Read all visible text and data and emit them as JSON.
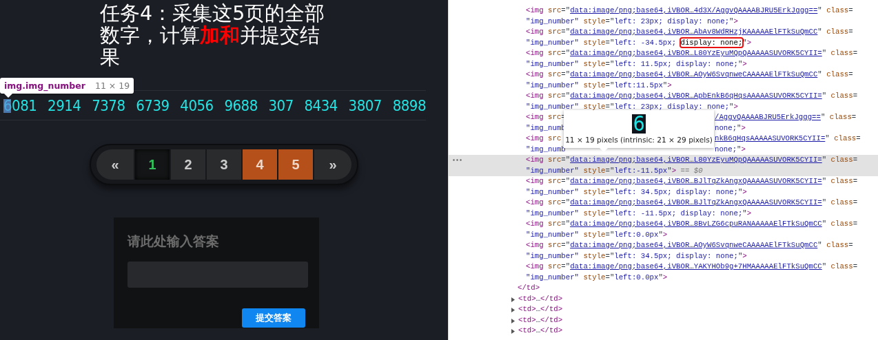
{
  "task_page": {
    "title": "任务4：采集这5页的全部数字，计算**加和**并提交结果",
    "inspect_tooltip": {
      "selector": "img.img_number",
      "size": "11 × 19"
    },
    "numbers": [
      "6081",
      "2914",
      "7378",
      "6739",
      "4056",
      "9688",
      "307",
      "8434",
      "3807",
      "8898"
    ],
    "pages": [
      {
        "label": "«",
        "kind": "arrow",
        "selected": false,
        "visited": false
      },
      {
        "label": "1",
        "kind": "page",
        "selected": true,
        "visited": false
      },
      {
        "label": "2",
        "kind": "page",
        "selected": false,
        "visited": false
      },
      {
        "label": "3",
        "kind": "page",
        "selected": false,
        "visited": false
      },
      {
        "label": "4",
        "kind": "page",
        "selected": false,
        "visited": true
      },
      {
        "label": "5",
        "kind": "page",
        "selected": false,
        "visited": true
      },
      {
        "label": "»",
        "kind": "arrow",
        "selected": false,
        "visited": false
      }
    ],
    "answer_card": {
      "title": "请此处输入答案",
      "submit_button": "提交答案"
    }
  },
  "devtools": {
    "image_tooltip": {
      "preview": "6",
      "caption": "11 × 19 pixels (intrinsic: 21 × 29 pixels)"
    },
    "dom_tree": [
      {
        "kind": "element",
        "expanded": true,
        "children": [
          {
            "kind": "img",
            "selected": false,
            "lines": [
              [
                [
                  {
                    "kind": "tag",
                    "text": "<img "
                  },
                  {
                    "kind": "attr",
                    "text": "src"
                  },
                  {
                    "kind": "eq",
                    "text": "=\""
                  },
                  {
                    "kind": "link",
                    "text": "data:image/png;base64,iVBOR…4d3X/AggvQAAAABJRU5ErkJggg=="
                  },
                  {
                    "kind": "eq",
                    "text": "\" "
                  },
                  {
                    "kind": "attr",
                    "text": "class"
                  },
                  {
                    "kind": "eq",
                    "text": "="
                  }
                ]
              ],
              [
                [
                  {
                    "kind": "val",
                    "text": "\"img_number\" "
                  },
                  {
                    "kind": "attr",
                    "text": "style"
                  },
                  {
                    "kind": "eq",
                    "text": "=\""
                  },
                  {
                    "kind": "val",
                    "text": "left: 23px; display: none;"
                  },
                  {
                    "kind": "eq",
                    "text": "\""
                  },
                  {
                    "kind": "tag",
                    "text": ">"
                  }
                ]
              ]
            ]
          },
          {
            "kind": "img",
            "selected": false,
            "lines": [
              [
                [
                  {
                    "kind": "tag",
                    "text": "<img "
                  },
                  {
                    "kind": "attr",
                    "text": "src"
                  },
                  {
                    "kind": "eq",
                    "text": "=\""
                  },
                  {
                    "kind": "link",
                    "text": "data:image/png;base64,iVBOR…AbAv8WdRHzjKAAAAAElFTkSuQmCC"
                  },
                  {
                    "kind": "eq",
                    "text": "\" "
                  },
                  {
                    "kind": "attr",
                    "text": "class"
                  },
                  {
                    "kind": "eq",
                    "text": "="
                  }
                ]
              ],
              [
                [
                  {
                    "kind": "val",
                    "text": "\"img_number\" "
                  },
                  {
                    "kind": "attr",
                    "text": "style"
                  },
                  {
                    "kind": "eq",
                    "text": "=\""
                  },
                  {
                    "kind": "val",
                    "text": "left: -34.5px; "
                  },
                  {
                    "kind": "boxed",
                    "text": "display: none;"
                  },
                  {
                    "kind": "eq",
                    "text": "\""
                  },
                  {
                    "kind": "tag",
                    "text": ">"
                  }
                ]
              ]
            ]
          },
          {
            "kind": "img",
            "selected": false,
            "lines": [
              [
                [
                  {
                    "kind": "tag",
                    "text": "<img "
                  },
                  {
                    "kind": "attr",
                    "text": "src"
                  },
                  {
                    "kind": "eq",
                    "text": "=\""
                  },
                  {
                    "kind": "link",
                    "text": "data:image/png;base64,iVBOR…L80YzEyuMQpQAAAAASUVORK5CYII="
                  },
                  {
                    "kind": "eq",
                    "text": "\" "
                  },
                  {
                    "kind": "attr",
                    "text": "class"
                  },
                  {
                    "kind": "eq",
                    "text": "="
                  }
                ]
              ],
              [
                [
                  {
                    "kind": "val",
                    "text": "\"img_number\" "
                  },
                  {
                    "kind": "attr",
                    "text": "style"
                  },
                  {
                    "kind": "eq",
                    "text": "=\""
                  },
                  {
                    "kind": "val",
                    "text": "left: 11.5px; display: none;"
                  },
                  {
                    "kind": "eq",
                    "text": "\""
                  },
                  {
                    "kind": "tag",
                    "text": ">"
                  }
                ]
              ]
            ]
          },
          {
            "kind": "img",
            "selected": false,
            "lines": [
              [
                [
                  {
                    "kind": "tag",
                    "text": "<img "
                  },
                  {
                    "kind": "attr",
                    "text": "src"
                  },
                  {
                    "kind": "eq",
                    "text": "=\""
                  },
                  {
                    "kind": "link",
                    "text": "data:image/png;base64,iVBOR…AOyW6SvqnweCAAAAAElFTkSuQmCC"
                  },
                  {
                    "kind": "eq",
                    "text": "\" "
                  },
                  {
                    "kind": "attr",
                    "text": "class"
                  },
                  {
                    "kind": "eq",
                    "text": "="
                  }
                ]
              ],
              [
                [
                  {
                    "kind": "val",
                    "text": "\"img_number\" "
                  },
                  {
                    "kind": "attr",
                    "text": "style"
                  },
                  {
                    "kind": "eq",
                    "text": "=\""
                  },
                  {
                    "kind": "val",
                    "text": "left:11.5px"
                  },
                  {
                    "kind": "eq",
                    "text": "\""
                  },
                  {
                    "kind": "tag",
                    "text": ">"
                  }
                ]
              ]
            ]
          },
          {
            "kind": "img",
            "selected": false,
            "lines": [
              [
                [
                  {
                    "kind": "tag",
                    "text": "<img "
                  },
                  {
                    "kind": "attr",
                    "text": "src"
                  },
                  {
                    "kind": "eq",
                    "text": "=\""
                  },
                  {
                    "kind": "link",
                    "text": "data:image/png;base64,iVBOR…ApbEnkB6qHqsAAAAASUVORK5CYII="
                  },
                  {
                    "kind": "eq",
                    "text": "\" "
                  },
                  {
                    "kind": "attr",
                    "text": "class"
                  },
                  {
                    "kind": "eq",
                    "text": "="
                  }
                ]
              ],
              [
                [
                  {
                    "kind": "val",
                    "text": "\"img_number\" "
                  },
                  {
                    "kind": "attr",
                    "text": "style"
                  },
                  {
                    "kind": "eq",
                    "text": "=\""
                  },
                  {
                    "kind": "val",
                    "text": "left: 23px; display: none;"
                  },
                  {
                    "kind": "eq",
                    "text": "\""
                  },
                  {
                    "kind": "tag",
                    "text": ">"
                  }
                ]
              ]
            ]
          },
          {
            "kind": "img",
            "selected": false,
            "lines": [
              [
                [
                  {
                    "kind": "tag",
                    "text": "<img "
                  },
                  {
                    "kind": "attr",
                    "text": "src"
                  },
                  {
                    "kind": "eq",
                    "text": "="
                  }
                ],
                [
                  {
                    "kind": "link",
                    "text": "/AggvQAAAABJRU5ErkJggg=="
                  },
                  {
                    "kind": "eq",
                    "text": "\" "
                  },
                  {
                    "kind": "attr",
                    "text": "class"
                  },
                  {
                    "kind": "eq",
                    "text": "="
                  }
                ]
              ],
              [
                [
                  {
                    "kind": "val",
                    "text": "\"img_numb"
                  }
                ],
                [
                  {
                    "kind": "val",
                    "text": "none;"
                  },
                  {
                    "kind": "eq",
                    "text": "\""
                  },
                  {
                    "kind": "tag",
                    "text": ">"
                  }
                ]
              ]
            ]
          },
          {
            "kind": "img",
            "selected": false,
            "lines": [
              [
                [
                  {
                    "kind": "tag",
                    "text": "<img "
                  },
                  {
                    "kind": "attr",
                    "text": "src"
                  }
                ],
                [
                  {
                    "kind": "link",
                    "text": "nkB6qHqsAAAAASUVORK5CYII="
                  },
                  {
                    "kind": "eq",
                    "text": "\" "
                  },
                  {
                    "kind": "attr",
                    "text": "class"
                  },
                  {
                    "kind": "eq",
                    "text": "="
                  }
                ]
              ],
              [
                [
                  {
                    "kind": "val",
                    "text": "\"img_numb"
                  }
                ],
                [
                  {
                    "kind": "val",
                    "text": "none;"
                  },
                  {
                    "kind": "eq",
                    "text": "\""
                  },
                  {
                    "kind": "tag",
                    "text": ">"
                  }
                ]
              ]
            ]
          },
          {
            "kind": "img",
            "selected": true,
            "lines": [
              [
                [
                  {
                    "kind": "tag",
                    "text": "<img "
                  },
                  {
                    "kind": "attr",
                    "text": "src"
                  },
                  {
                    "kind": "eq",
                    "text": "=\""
                  },
                  {
                    "kind": "link",
                    "text": "data:image/png;base64,iVBOR…L80YzEyuMQpQAAAAASUVORK5CYII="
                  },
                  {
                    "kind": "eq",
                    "text": "\" "
                  },
                  {
                    "kind": "attr",
                    "text": "class"
                  },
                  {
                    "kind": "eq",
                    "text": "="
                  }
                ]
              ],
              [
                [
                  {
                    "kind": "val",
                    "text": "\"img_number\" "
                  },
                  {
                    "kind": "attr",
                    "text": "style"
                  },
                  {
                    "kind": "eq",
                    "text": "=\""
                  },
                  {
                    "kind": "val",
                    "text": "left:-11.5px"
                  },
                  {
                    "kind": "eq",
                    "text": "\""
                  },
                  {
                    "kind": "tag",
                    "text": ">"
                  },
                  {
                    "kind": "dim",
                    "text": " == $0"
                  }
                ]
              ]
            ]
          },
          {
            "kind": "img",
            "selected": false,
            "lines": [
              [
                [
                  {
                    "kind": "tag",
                    "text": "<img "
                  },
                  {
                    "kind": "attr",
                    "text": "src"
                  },
                  {
                    "kind": "eq",
                    "text": "=\""
                  },
                  {
                    "kind": "link",
                    "text": "data:image/png;base64,iVBOR…BJlTqZkAngxQAAAAASUVORK5CYII="
                  },
                  {
                    "kind": "eq",
                    "text": "\" "
                  },
                  {
                    "kind": "attr",
                    "text": "class"
                  },
                  {
                    "kind": "eq",
                    "text": "="
                  }
                ]
              ],
              [
                [
                  {
                    "kind": "val",
                    "text": "\"img_number\" "
                  },
                  {
                    "kind": "attr",
                    "text": "style"
                  },
                  {
                    "kind": "eq",
                    "text": "=\""
                  },
                  {
                    "kind": "val",
                    "text": "left: 34.5px; display: none;"
                  },
                  {
                    "kind": "eq",
                    "text": "\""
                  },
                  {
                    "kind": "tag",
                    "text": ">"
                  }
                ]
              ]
            ]
          },
          {
            "kind": "img",
            "selected": false,
            "lines": [
              [
                [
                  {
                    "kind": "tag",
                    "text": "<img "
                  },
                  {
                    "kind": "attr",
                    "text": "src"
                  },
                  {
                    "kind": "eq",
                    "text": "=\""
                  },
                  {
                    "kind": "link",
                    "text": "data:image/png;base64,iVBOR…BJlTqZkAngxQAAAAASUVORK5CYII="
                  },
                  {
                    "kind": "eq",
                    "text": "\" "
                  },
                  {
                    "kind": "attr",
                    "text": "class"
                  },
                  {
                    "kind": "eq",
                    "text": "="
                  }
                ]
              ],
              [
                [
                  {
                    "kind": "val",
                    "text": "\"img_number\" "
                  },
                  {
                    "kind": "attr",
                    "text": "style"
                  },
                  {
                    "kind": "eq",
                    "text": "=\""
                  },
                  {
                    "kind": "val",
                    "text": "left: -11.5px; display: none;"
                  },
                  {
                    "kind": "eq",
                    "text": "\""
                  },
                  {
                    "kind": "tag",
                    "text": ">"
                  }
                ]
              ]
            ]
          },
          {
            "kind": "img",
            "selected": false,
            "lines": [
              [
                [
                  {
                    "kind": "tag",
                    "text": "<img "
                  },
                  {
                    "kind": "attr",
                    "text": "src"
                  },
                  {
                    "kind": "eq",
                    "text": "=\""
                  },
                  {
                    "kind": "link",
                    "text": "data:image/png;base64,iVBOR…8BvLZG6cpuRANAAAAAElFTkSuQmCC"
                  },
                  {
                    "kind": "eq",
                    "text": "\" "
                  },
                  {
                    "kind": "attr",
                    "text": "class"
                  },
                  {
                    "kind": "eq",
                    "text": "="
                  }
                ]
              ],
              [
                [
                  {
                    "kind": "val",
                    "text": "\"img_number\" "
                  },
                  {
                    "kind": "attr",
                    "text": "style"
                  },
                  {
                    "kind": "eq",
                    "text": "=\""
                  },
                  {
                    "kind": "val",
                    "text": "left:0.0px"
                  },
                  {
                    "kind": "eq",
                    "text": "\""
                  },
                  {
                    "kind": "tag",
                    "text": ">"
                  }
                ]
              ]
            ]
          },
          {
            "kind": "img",
            "selected": false,
            "lines": [
              [
                [
                  {
                    "kind": "tag",
                    "text": "<img "
                  },
                  {
                    "kind": "attr",
                    "text": "src"
                  },
                  {
                    "kind": "eq",
                    "text": "=\""
                  },
                  {
                    "kind": "link",
                    "text": "data:image/png;base64,iVBOR…AOyW6SvqnweCAAAAAElFTkSuQmCC"
                  },
                  {
                    "kind": "eq",
                    "text": "\" "
                  },
                  {
                    "kind": "attr",
                    "text": "class"
                  },
                  {
                    "kind": "eq",
                    "text": "="
                  }
                ]
              ],
              [
                [
                  {
                    "kind": "val",
                    "text": "\"img_number\" "
                  },
                  {
                    "kind": "attr",
                    "text": "style"
                  },
                  {
                    "kind": "eq",
                    "text": "=\""
                  },
                  {
                    "kind": "val",
                    "text": "left: 34.5px; display: none;"
                  },
                  {
                    "kind": "eq",
                    "text": "\""
                  },
                  {
                    "kind": "tag",
                    "text": ">"
                  }
                ]
              ]
            ]
          },
          {
            "kind": "img",
            "selected": false,
            "lines": [
              [
                [
                  {
                    "kind": "tag",
                    "text": "<img "
                  },
                  {
                    "kind": "attr",
                    "text": "src"
                  },
                  {
                    "kind": "eq",
                    "text": "=\""
                  },
                  {
                    "kind": "link",
                    "text": "data:image/png;base64,iVBOR…YAKYHOb9g+7HMAAAAAElFTkSuQmCC"
                  },
                  {
                    "kind": "eq",
                    "text": "\" "
                  },
                  {
                    "kind": "attr",
                    "text": "class"
                  },
                  {
                    "kind": "eq",
                    "text": "="
                  }
                ]
              ],
              [
                [
                  {
                    "kind": "val",
                    "text": "\"img_number\" "
                  },
                  {
                    "kind": "attr",
                    "text": "style"
                  },
                  {
                    "kind": "eq",
                    "text": "=\""
                  },
                  {
                    "kind": "val",
                    "text": "left:0.0px"
                  },
                  {
                    "kind": "eq",
                    "text": "\""
                  },
                  {
                    "kind": "tag",
                    "text": ">"
                  }
                ]
              ]
            ]
          }
        ],
        "close": [
          [
            {
              "kind": "tag",
              "text": "</td>"
            }
          ]
        ]
      },
      {
        "kind": "element",
        "expanded": false,
        "lines": [
          [
            [
              {
                "kind": "tag",
                "text": "<td>"
              },
              {
                "kind": "eq",
                "text": "…"
              },
              {
                "kind": "tag",
                "text": "</td>"
              }
            ]
          ]
        ]
      },
      {
        "kind": "element",
        "expanded": false,
        "lines": [
          [
            [
              {
                "kind": "tag",
                "text": "<td>"
              },
              {
                "kind": "eq",
                "text": "…"
              },
              {
                "kind": "tag",
                "text": "</td>"
              }
            ]
          ]
        ]
      },
      {
        "kind": "element",
        "expanded": false,
        "lines": [
          [
            [
              {
                "kind": "tag",
                "text": "<td>"
              },
              {
                "kind": "eq",
                "text": "…"
              },
              {
                "kind": "tag",
                "text": "</td>"
              }
            ]
          ]
        ]
      },
      {
        "kind": "element",
        "expanded": false,
        "lines": [
          [
            [
              {
                "kind": "tag",
                "text": "<td>"
              },
              {
                "kind": "eq",
                "text": "…"
              },
              {
                "kind": "tag",
                "text": "</td>"
              }
            ]
          ]
        ]
      }
    ]
  }
}
